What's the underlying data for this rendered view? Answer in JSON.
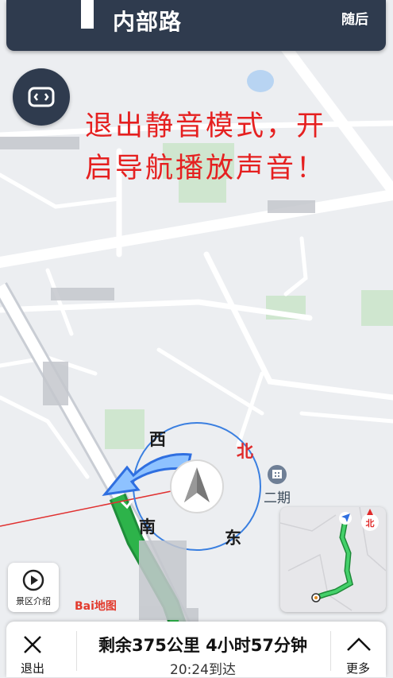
{
  "nav": {
    "road_name": "内部路",
    "then_label": "随后"
  },
  "voice_button": {
    "icon": "robot-face-icon"
  },
  "overlay_caption": {
    "line1": "退出静音模式，开",
    "line2": "启导航播放声音！"
  },
  "compass": {
    "west": "西",
    "north": "北",
    "south": "南",
    "east": "东"
  },
  "poi": {
    "label": "二期",
    "icon": "building-pin-icon"
  },
  "scenic": {
    "label": "景区介绍",
    "icon": "play-circle-icon"
  },
  "logo": {
    "text": "Bai地图"
  },
  "minimap": {
    "north_label": "北"
  },
  "bottom": {
    "exit_label": "退出",
    "remaining": "剩余375公里 4小时57分钟",
    "arrival": "20:24到达",
    "more_label": "更多"
  },
  "colors": {
    "panel_dark": "#2f3b4e",
    "route_green": "#2db34a",
    "caption_red": "#e52020",
    "compass_blue": "#3a7fe0"
  }
}
